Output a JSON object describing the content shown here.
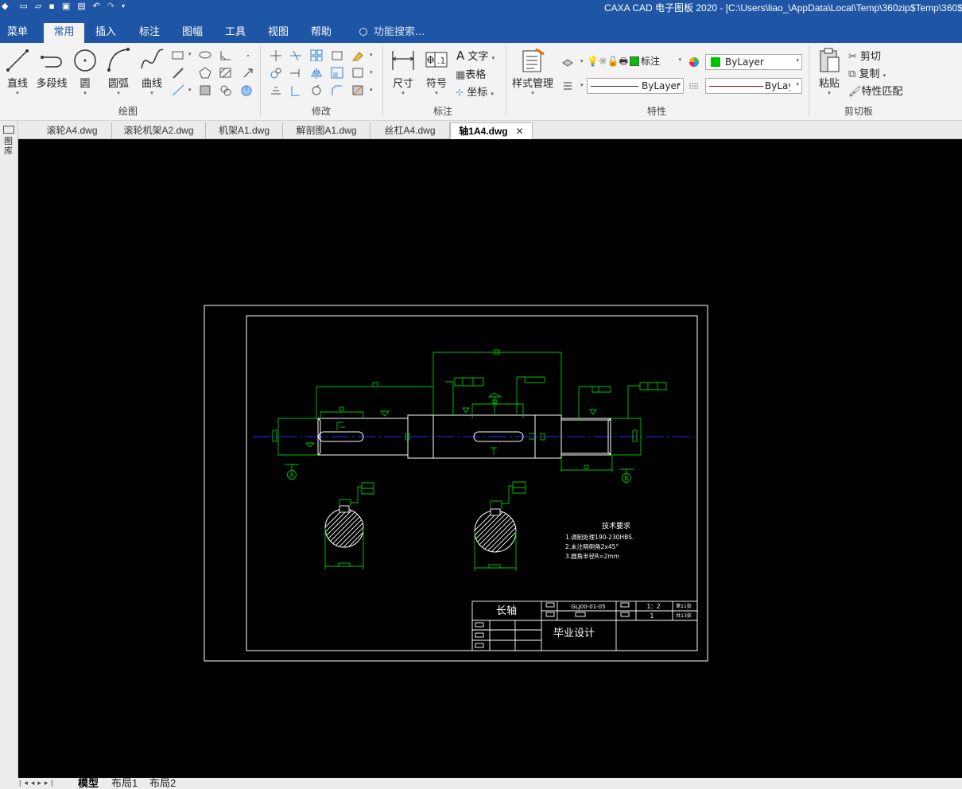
{
  "window": {
    "title": "CAXA CAD 电子图板 2020 - [C:\\Users\\liao_\\AppData\\Local\\Temp\\360zip$Temp\\360$"
  },
  "menu": {
    "tabs": [
      {
        "label": "菜单"
      },
      {
        "label": "常用"
      },
      {
        "label": "插入"
      },
      {
        "label": "标注"
      },
      {
        "label": "图幅"
      },
      {
        "label": "工具"
      },
      {
        "label": "视图"
      },
      {
        "label": "帮助"
      }
    ],
    "active_index": 1,
    "search_placeholder": "功能搜索..."
  },
  "ribbon": {
    "draw": {
      "group_label": "绘图",
      "line": "直线",
      "polyline": "多段线",
      "circle": "圆",
      "arc": "圆弧",
      "curve": "曲线"
    },
    "modify": {
      "group_label": "修改"
    },
    "annotate": {
      "group_label": "标注",
      "dimension": "尺寸",
      "symbol": "符号",
      "text": "文字",
      "table": "表格",
      "coordinate": "坐标"
    },
    "properties": {
      "group_label": "特性",
      "style_manager": "样式管理",
      "layer_name": "标注",
      "color_value": "ByLayer",
      "linetype_value": "ByLayer",
      "lineweight_value": "ByLayer"
    },
    "clipboard": {
      "group_label": "剪切板",
      "paste": "粘贴",
      "cut": "剪切",
      "copy": "复制",
      "match_props": "特性匹配"
    }
  },
  "documents": {
    "tabs": [
      {
        "label": "滚轮A4.dwg"
      },
      {
        "label": "滚轮机架A2.dwg"
      },
      {
        "label": "机架A1.dwg"
      },
      {
        "label": "解剖图A1.dwg"
      },
      {
        "label": "丝杠A4.dwg"
      },
      {
        "label": "轴1A4.dwg"
      }
    ],
    "active_index": 5
  },
  "left_panel": {
    "label": "图库"
  },
  "drawing": {
    "tech_requirements": {
      "title": "技术要求",
      "items": [
        "1.调制处理190-230HBS.",
        "2.未注明倒角2x45°",
        "3.圆角半径R=2mm"
      ]
    },
    "title_block": {
      "part_name": "长轴",
      "drawing_no": "GLJ00-01-05",
      "scale": "1：2",
      "quantity": "1",
      "sheet_no": "第11张",
      "sheet_total": "共13张",
      "project": "毕业设计"
    },
    "datum_a": "A",
    "datum_b": "B"
  },
  "layouts": {
    "tabs": [
      {
        "label": "模型"
      },
      {
        "label": "布局1"
      },
      {
        "label": "布局2"
      }
    ],
    "active_index": 0
  },
  "colors": {
    "titlebar": "#1f55a5",
    "ribbon": "#f3f3f3",
    "canvas": "#000000",
    "geometry": "#ffffff",
    "dimension": "#00c800",
    "centerline": "#0000ff",
    "layer_swatch": "#00c000",
    "linetype_red": "#c00000"
  }
}
